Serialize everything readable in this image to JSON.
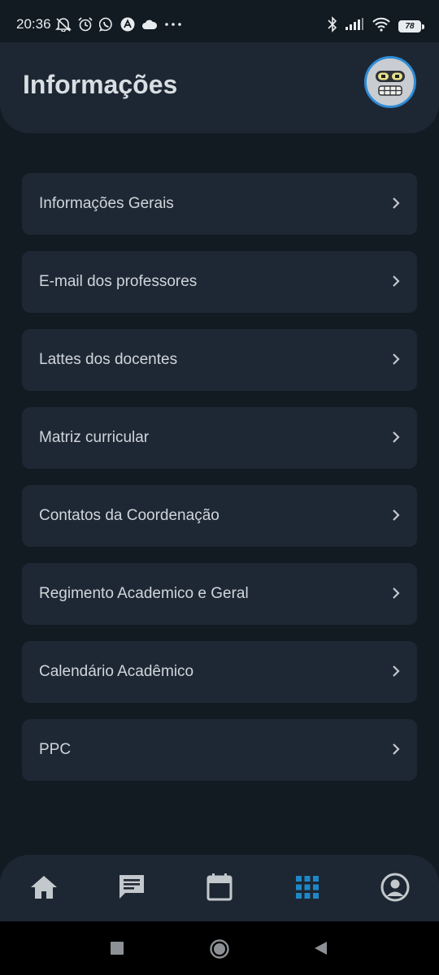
{
  "status_bar": {
    "time": "20:36",
    "battery_level": "78",
    "left_icons": [
      "notifications-off-icon",
      "alarm-icon",
      "whatsapp-icon",
      "app-icon",
      "cloud-icon",
      "more-icon"
    ],
    "right_icons": [
      "bluetooth-icon",
      "signal-icon",
      "wifi-icon",
      "battery-icon"
    ]
  },
  "header": {
    "title": "Informações",
    "avatar_icon": "robot-avatar-icon"
  },
  "menu": {
    "items": [
      {
        "label": "Informações Gerais"
      },
      {
        "label": "E-mail dos professores"
      },
      {
        "label": "Lattes dos docentes"
      },
      {
        "label": "Matriz curricular"
      },
      {
        "label": "Contatos da Coordenação"
      },
      {
        "label": "Regimento Academico e Geral"
      },
      {
        "label": "Calendário Acadêmico"
      },
      {
        "label": "PPC"
      }
    ],
    "chevron_icon": "chevron-right-icon"
  },
  "bottom_nav": {
    "items": [
      {
        "icon": "home-icon",
        "active": false
      },
      {
        "icon": "chat-icon",
        "active": false
      },
      {
        "icon": "calendar-icon",
        "active": false
      },
      {
        "icon": "grid-icon",
        "active": true
      },
      {
        "icon": "profile-icon",
        "active": false
      }
    ]
  },
  "colors": {
    "background": "#121a22",
    "card": "#1e2835",
    "header": "#1d2733",
    "accent": "#1e88c7",
    "text": "#d0d5da",
    "icon_inactive": "#c3c8cd"
  }
}
